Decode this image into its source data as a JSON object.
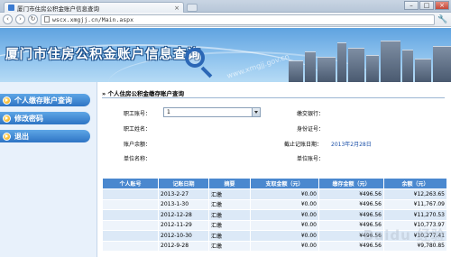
{
  "browser": {
    "tab_title": "厦门市住房公积金账户信息查询",
    "tab_close": "×",
    "new_tab": "",
    "url": "wscx.xmgjj.cn/Main.aspx",
    "win_min": "–",
    "win_max": "□",
    "win_close": "×",
    "back": "‹",
    "forward": "›",
    "reload": "↻",
    "menu": "🔧"
  },
  "banner": {
    "title": "厦门市住房公积金账户信息查询",
    "watermark": "www.xmgjj.gov.cn"
  },
  "sidebar": {
    "items": [
      {
        "label": "个人缴存账户查询"
      },
      {
        "label": "修改密码"
      },
      {
        "label": "退出"
      }
    ]
  },
  "main": {
    "section_title": "»  个人住房公积金缴存账户查询",
    "labels": {
      "account_no": "职工账号：",
      "bank": "缴交银行：",
      "name": "职工姓名：",
      "id_no": "身份证号：",
      "balance": "账户余额：",
      "deadline": "截止记账日期：",
      "unit_name": "单位名称：",
      "unit_no": "单位账号："
    },
    "account_select_value": "1",
    "deadline_value": "2013年2月28日"
  },
  "table": {
    "headers": [
      "个人账号",
      "记账日期",
      "摘要",
      "支取金额（元）",
      "缴存金额（元）",
      "余额（元）"
    ],
    "rows": [
      [
        "",
        "2013-2-27",
        "汇缴",
        "¥0.00",
        "¥496.56",
        "¥12,263.65"
      ],
      [
        "",
        "2013-1-30",
        "汇缴",
        "¥0.00",
        "¥496.56",
        "¥11,767.09"
      ],
      [
        "",
        "2012-12-28",
        "汇缴",
        "¥0.00",
        "¥496.56",
        "¥11,270.53"
      ],
      [
        "",
        "2012-11-29",
        "汇缴",
        "¥0.00",
        "¥496.56",
        "¥10,773.97"
      ],
      [
        "",
        "2012-10-30",
        "汇缴",
        "¥0.00",
        "¥496.56",
        "¥10,277.41"
      ],
      [
        "",
        "2012-9-28",
        "汇缴",
        "¥0.00",
        "¥496.56",
        "¥9,780.85"
      ]
    ]
  },
  "watermark_text": "Baidu 经验"
}
